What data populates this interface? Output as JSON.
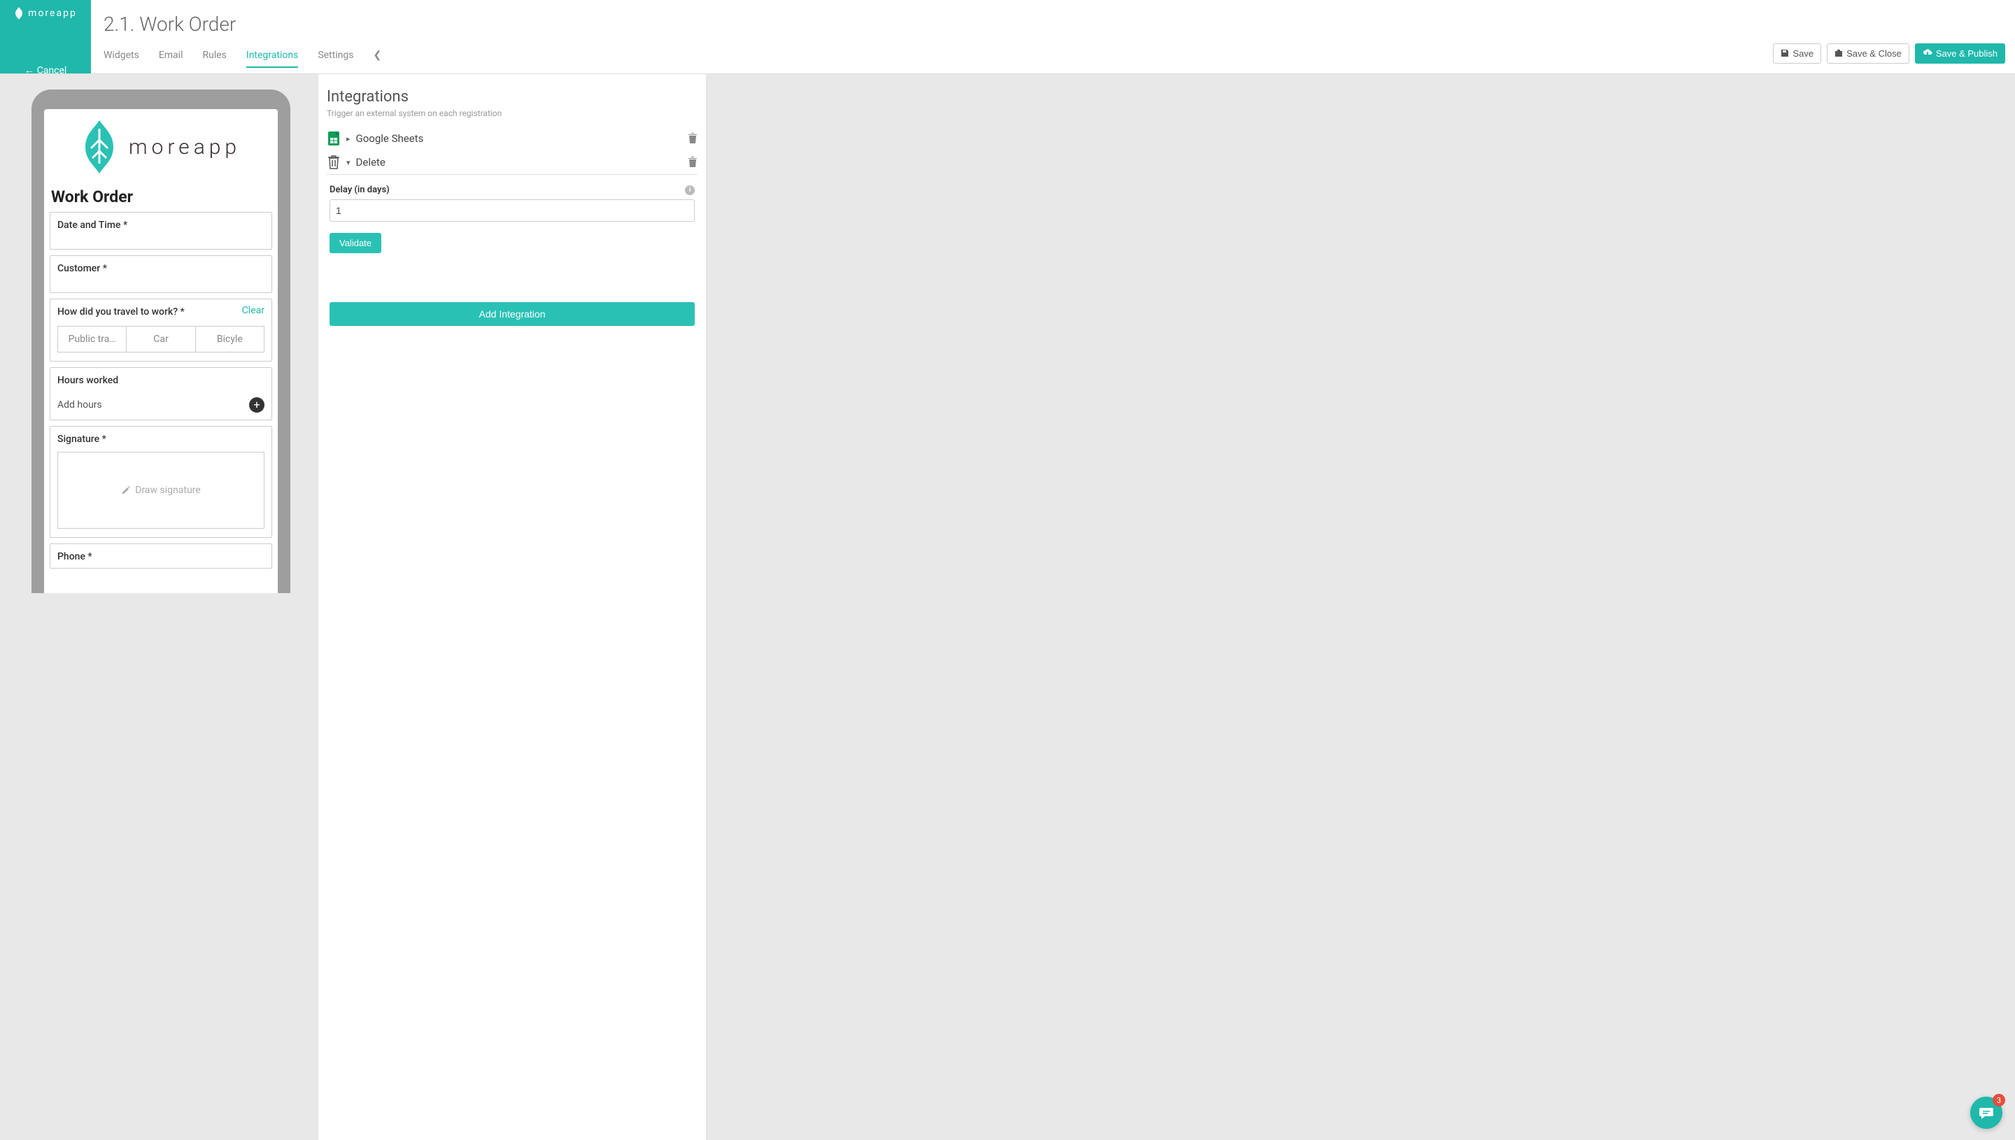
{
  "brand": {
    "name": "moreapp"
  },
  "cancel_label": "Cancel",
  "page_title": "2.1. Work Order",
  "tabs": {
    "widgets": "Widgets",
    "email": "Email",
    "rules": "Rules",
    "integrations": "Integrations",
    "settings": "Settings"
  },
  "actions": {
    "save": "Save",
    "save_close": "Save & Close",
    "save_publish": "Save & Publish"
  },
  "preview": {
    "app_brand": "moreapp",
    "form_title": "Work Order",
    "fields": {
      "datetime_label": "Date and Time *",
      "customer_label": "Customer *",
      "travel_label": "How did you travel to work? *",
      "travel_clear": "Clear",
      "travel_options": [
        "Public tra…",
        "Car",
        "Bicyle"
      ],
      "hours_label": "Hours worked",
      "add_hours": "Add hours",
      "signature_label": "Signature *",
      "signature_placeholder": "Draw signature",
      "phone_label": "Phone *"
    }
  },
  "integrations": {
    "title": "Integrations",
    "subtitle": "Trigger an external system on each registration",
    "items": [
      {
        "label": "Google Sheets",
        "expanded": false
      },
      {
        "label": "Delete",
        "expanded": true
      }
    ],
    "delay_label": "Delay (in days)",
    "delay_value": "1",
    "validate": "Validate",
    "add": "Add Integration"
  },
  "chat": {
    "unread": "3"
  }
}
